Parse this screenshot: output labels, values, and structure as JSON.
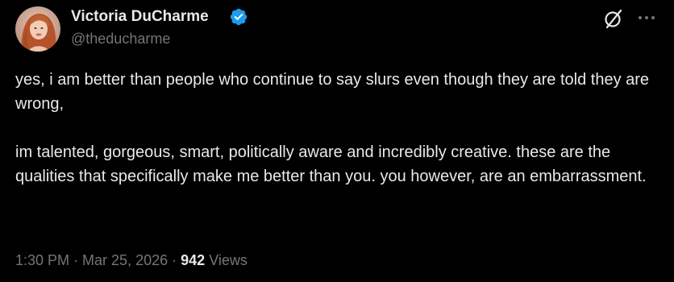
{
  "author": {
    "display_name": "Victoria DuCharme",
    "handle": "@theducharme",
    "verified_color": "#1d9bf0",
    "avatar_icon": "profile-photo"
  },
  "header_actions": {
    "grok_icon": "grok-icon",
    "more_icon": "more-icon"
  },
  "tweet": {
    "paragraphs": [
      "yes, i am better than people who continue to say slurs even though they are told they are wrong,",
      "im talented, gorgeous, smart, politically aware and incredibly creative. these are the qualities that specifically make me better than you. you however, are an embarrassment."
    ]
  },
  "meta": {
    "time": "1:30 PM",
    "separator": " · ",
    "date": "Mar 25, 2026",
    "views_count": "942",
    "views_label": "Views"
  },
  "colors": {
    "background": "#000000",
    "primary_text": "#e7e9ea",
    "secondary_text": "#71767b",
    "accent": "#1d9bf0"
  }
}
